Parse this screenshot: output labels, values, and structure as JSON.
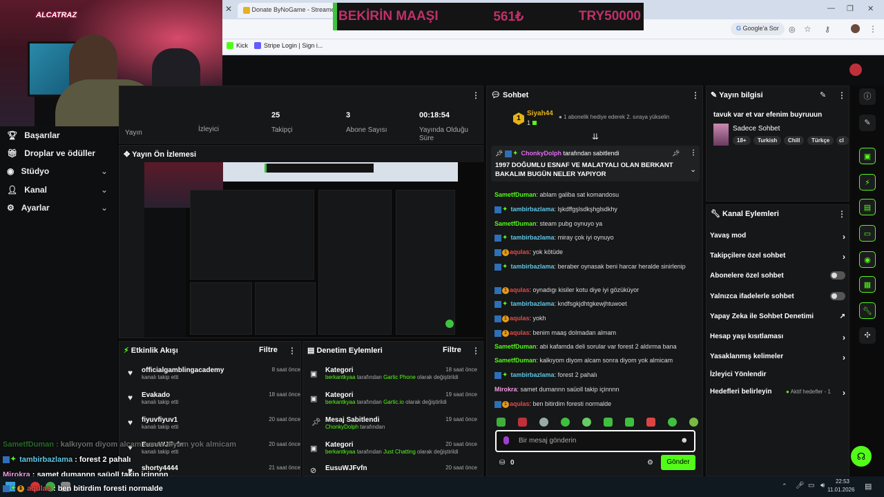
{
  "browser": {
    "tab_label": "Donate ByNoGame - Streamer",
    "search_pill": "Google'a Sor",
    "bookmarks": [
      "Kick",
      "Stripe Login | Sign i..."
    ]
  },
  "banner": {
    "title": "BEKİRİN MAAŞI",
    "amount": "561₺",
    "goal": "TRY50000"
  },
  "webcam": {
    "logo": "ALCATRAZ"
  },
  "sidebar": {
    "items": [
      {
        "label": "Başarılar",
        "icon": "trophy-icon"
      },
      {
        "label": "Droplar ve ödüller",
        "icon": "gift-icon"
      },
      {
        "label": "Stüdyo",
        "icon": "gear-icon"
      },
      {
        "label": "Kanal",
        "icon": "person-icon"
      },
      {
        "label": "Ayarlar",
        "icon": "gear-icon"
      }
    ]
  },
  "stats": {
    "items": [
      {
        "value": "",
        "label": "Yayın"
      },
      {
        "value": "",
        "label": "İzleyici"
      },
      {
        "value": "25",
        "label": "Takipçi"
      },
      {
        "value": "3",
        "label": "Abone Sayısı"
      },
      {
        "value": "00:18:54",
        "label": "Yayında Olduğu Süre"
      }
    ]
  },
  "preview": {
    "title": "Yayın Ön İzlemesi"
  },
  "activity": {
    "title": "Etkinlik Akışı",
    "filter": "Filtre",
    "items": [
      {
        "name": "officialgamblingacademy",
        "desc": "kanalı takip etti",
        "time": "8 saat önce"
      },
      {
        "name": "Evakado",
        "desc": "kanalı takip etti",
        "time": "18 saat önce"
      },
      {
        "name": "fiyuvfiyuv1",
        "desc": "kanalı takip etti",
        "time": "20 saat önce"
      },
      {
        "name": "EusuWJFvfn",
        "desc": "kanalı takip etti",
        "time": "20 saat önce"
      },
      {
        "name": "shorty4444",
        "desc": "",
        "time": "21 saat önce"
      }
    ]
  },
  "moderation": {
    "title": "Denetim Eylemleri",
    "filter": "Filtre",
    "items": [
      {
        "title": "Kategori",
        "user": "berkantkyaa",
        "mid": " tarafından ",
        "value": "Gartic Phone",
        "tail": " olarak değiştirildi",
        "time": "18 saat önce"
      },
      {
        "title": "Kategori",
        "user": "berkantkyaa",
        "mid": " tarafından ",
        "value": "Gartic.io",
        "tail": " olarak değiştirildi",
        "time": "19 saat önce"
      },
      {
        "title": "Mesaj Sabitlendi",
        "user": "ChonkyDolph",
        "mid": " tarafından",
        "value": "",
        "tail": "",
        "time": "19 saat önce"
      },
      {
        "title": "Kategori",
        "user": "berkantkyaa",
        "mid": " tarafından ",
        "value": "Just Chatting",
        "tail": " olarak değiştirildi",
        "time": "20 saat önce"
      },
      {
        "title": "EusuWJFvfn",
        "user": "",
        "mid": "",
        "value": "",
        "tail": "",
        "time": "20 saat önce"
      }
    ]
  },
  "chat": {
    "title": "Sohbet",
    "gifter": {
      "rank": "1",
      "name": "Siyah44",
      "count": "1",
      "text": "1 abonelik hediye ederek 2. sıraya yükselin"
    },
    "pinned": {
      "by": "ChonkyDolph",
      "by_suffix": "tarafından sabitlendi",
      "text": "1997 DOĞUMLU ESNAF VE MALATYALI OLAN BERKANT BAKALIM BUGÜN NELER YAPIYOR"
    },
    "messages": [
      {
        "badges": "",
        "user": "SametfDuman",
        "cls": "u-green",
        "text": "ablam galiba sat komandosu"
      },
      {
        "badges": "bg",
        "user": "tambirbazlama",
        "cls": "u-blue",
        "text": "lşkdffgşlsdkşhglsdkhy"
      },
      {
        "badges": "",
        "user": "SametfDuman",
        "cls": "u-green",
        "text": "steam pubg oynuyo ya"
      },
      {
        "badges": "bg",
        "user": "tambirbazlama",
        "cls": "u-blue",
        "text": "miray çok iyi oynuyo"
      },
      {
        "badges": "bor",
        "user": "aqulas",
        "cls": "u-red",
        "text": "yok kötüde"
      },
      {
        "badges": "bg",
        "user": "tambirbazlama",
        "cls": "u-blue",
        "text": "beraber oynasak beni harcar heralde sinirlenip"
      },
      {
        "badges": "bor",
        "user": "aqulas",
        "cls": "u-red",
        "text": "oynadıgı kisiler kotu diye iyi gözüküyor"
      },
      {
        "badges": "bg",
        "user": "tambirbazlama",
        "cls": "u-blue",
        "text": "kndfsgkjdhtgkewjhtuwoet"
      },
      {
        "badges": "bor",
        "user": "aqulas",
        "cls": "u-red",
        "text": "yokh"
      },
      {
        "badges": "bor",
        "user": "aqulas",
        "cls": "u-red",
        "text": "benim maaş dolmadan almam"
      },
      {
        "badges": "",
        "user": "SametfDuman",
        "cls": "u-green",
        "text": "abi kafamda deli sorular var forest 2 aldırma bana"
      },
      {
        "badges": "",
        "user": "SametfDuman",
        "cls": "u-green",
        "text": "kalkıyom diyom alcam sonra diyom yok almicam"
      },
      {
        "badges": "bg",
        "user": "tambirbazlama",
        "cls": "u-blue",
        "text": "forest 2 pahalı"
      },
      {
        "badges": "",
        "user": "Mirokra",
        "cls": "u-pink",
        "text": "samet dumannn saüoll takip içinnnn"
      },
      {
        "badges": "bor",
        "user": "aqulas",
        "cls": "u-red",
        "text": "ben bitirdim foresti normalde"
      }
    ],
    "input_placeholder": "Bir mesaj gönderin",
    "count": "0",
    "send": "Gönder"
  },
  "stream_info": {
    "title": "Yayın bilgisi",
    "stream_title": "tavuk var et var efenim buyruuun",
    "category": "Sadece Sohbet",
    "tags": [
      "18+",
      "Turkish",
      "Chill",
      "Türkçe",
      "cl"
    ]
  },
  "channel_actions": {
    "title": "Kanal Eylemleri",
    "items": [
      {
        "label": "Yavaş mod",
        "control": "arrow"
      },
      {
        "label": "Takipçilere özel sohbet",
        "control": "arrow"
      },
      {
        "label": "Abonelere özel sohbet",
        "control": "toggle"
      },
      {
        "label": "Yalnızca ifadelerle sohbet",
        "control": "toggle"
      },
      {
        "label": "Yapay Zeka ile Sohbet Denetimi",
        "control": "external"
      },
      {
        "label": "Hesap yaşı kısıtlaması",
        "control": "arrow"
      },
      {
        "label": "Yasaklanmış kelimeler",
        "control": "arrow"
      },
      {
        "label": "İzleyici Yönlendir",
        "control": "none"
      },
      {
        "label": "Hedefleri belirleyin",
        "control": "arrow",
        "status": "Aktif hedefler - 1"
      }
    ]
  },
  "overlay_chat": [
    {
      "user": "SametfDuman",
      "text": "kalkıyom diyom alcam sonra diyom yok almicam"
    },
    {
      "user": "tambirbazlama",
      "text": "forest 2 pahalı"
    },
    {
      "user": "Mirokra",
      "text": "samet dumannn saüoll takip içinnnn"
    },
    {
      "user": "aqulas",
      "text": "ben bitirdim foresti normalde"
    }
  ],
  "taskbar": {
    "time": "22:53",
    "date": "11.01.2026"
  },
  "colors": {
    "accent": "#53fc18",
    "panel": "#161718",
    "banner_text": "#c0306a"
  }
}
